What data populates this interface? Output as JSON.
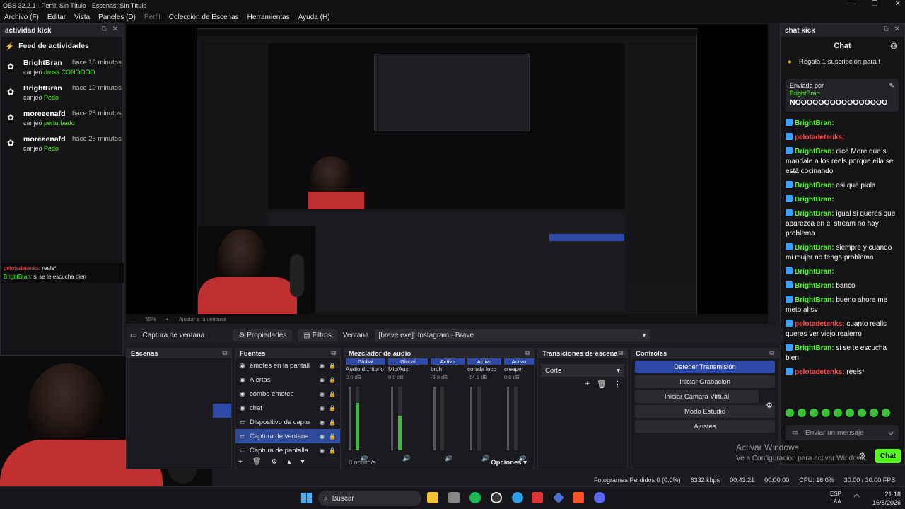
{
  "window": {
    "title": "OBS 32.2.1 - Perfil: Sin Título - Escenas: Sin Título"
  },
  "menu": {
    "items": [
      "Archivo (F)",
      "Editar",
      "Vista",
      "Paneles (D)",
      "Perfil",
      "Colección de Escenas",
      "Herramientas",
      "Ayuda (H)"
    ]
  },
  "activity": {
    "dock_title": "actividad kick",
    "feed_title": "Feed de actividades",
    "items": [
      {
        "name": "BrightBran",
        "time": "hace 16 minutos",
        "prefix": "canjeó",
        "reward": "dross COÑOOOO"
      },
      {
        "name": "BrightBran",
        "time": "hace 19 minutos",
        "prefix": "canjeó",
        "reward": "Pedo"
      },
      {
        "name": "moreeenafd",
        "time": "hace 25 minutos",
        "prefix": "canjeó",
        "reward": "perturbado"
      },
      {
        "name": "moreeenafd",
        "time": "hace 25 minutos",
        "prefix": "canjeó",
        "reward": "Pedo"
      }
    ]
  },
  "overlay_chat": [
    {
      "user": "pelotadetenks",
      "text": ": reels*"
    },
    {
      "user": "BrightBran",
      "text": ": si se te escucha bien"
    }
  ],
  "chat": {
    "dock_title": "chat kick",
    "header": "Chat",
    "sub_banner": "Regala 1 suscripción para t",
    "pinned_label": "Enviado por",
    "pinned_user": "BrightBran",
    "pinned_text": "NOOOOOOOOOOOOOOOO",
    "messages": [
      {
        "user": "BrightBran:",
        "text": "",
        "red": false
      },
      {
        "user": "pelotadetenks:",
        "text": "",
        "red": true
      },
      {
        "user": "BrightBran:",
        "text": "dice More que si, mandale a los reels porque ella se está cocinando",
        "red": false
      },
      {
        "user": "BrightBran:",
        "text": "asi que piola",
        "red": false
      },
      {
        "user": "BrightBran:",
        "text": "",
        "red": false
      },
      {
        "user": "BrightBran:",
        "text": "igual si querés que aparezca en el stream no hay problema",
        "red": false
      },
      {
        "user": "BrightBran:",
        "text": "siempre y cuando mi mujer no tenga problema",
        "red": false
      },
      {
        "user": "BrightBran:",
        "text": "",
        "red": false
      },
      {
        "user": "BrightBran:",
        "text": "banco",
        "red": false
      },
      {
        "user": "BrightBran:",
        "text": "bueno ahora me meto al sv",
        "red": false
      },
      {
        "user": "pelotadetenks:",
        "text": "cuanto realls queres ver viejo realerro",
        "red": true
      },
      {
        "user": "BrightBran:",
        "text": "si se te escucha bien",
        "red": false
      },
      {
        "user": "pelotadetenks:",
        "text": "reels*",
        "red": true
      }
    ],
    "input_placeholder": "Enviar un mensaje",
    "send_label": "Chat"
  },
  "preview_bar": {
    "zoom": "55%",
    "fit": "Ajustar a la ventana"
  },
  "source_bar": {
    "source_name": "Captura de ventana",
    "props_label": "Propiedades",
    "filters_label": "Filtros",
    "window_label": "Ventana",
    "window_value": "[brave.exe]: Instagram - Brave"
  },
  "panels": {
    "scenes_title": "Escenas",
    "sources_title": "Fuentes",
    "mixer_title": "Mezclador de audio",
    "transitions_title": "Transiciones de escena",
    "controls_title": "Controles"
  },
  "sources": [
    {
      "name": "emotes en la pantall",
      "selected": false
    },
    {
      "name": "Alertas",
      "selected": false
    },
    {
      "name": "combo emotes",
      "selected": false
    },
    {
      "name": "chat",
      "selected": false
    },
    {
      "name": "Dispositivo de captu",
      "selected": false
    },
    {
      "name": "Captura de ventana",
      "selected": true
    },
    {
      "name": "Captura de pantalla",
      "selected": false
    }
  ],
  "mixer": {
    "channels": [
      {
        "head": "Global",
        "name": "Audio d...ritorio",
        "db": "0.0 dB",
        "level": 0.75
      },
      {
        "head": "Global",
        "name": "Mic/Aux",
        "db": "0.0 dB",
        "level": 0.55
      },
      {
        "head": "Activo",
        "name": "bruh",
        "db": "-9.8 dB",
        "level": 0.0
      },
      {
        "head": "Activo",
        "name": "cortala loco",
        "db": "-14.1 dB",
        "level": 0.0
      },
      {
        "head": "Activo",
        "name": "creeper",
        "db": "0.0 dB",
        "level": 0.0
      }
    ],
    "hidden_label": "0 oculto/s",
    "options_label": "Opciones"
  },
  "transition": {
    "value": "Corte"
  },
  "controls": [
    "Detener Transmisión",
    "Iniciar Grabación",
    "Iniciar Cámara Virtual",
    "Modo Estudio",
    "Ajustes"
  ],
  "status": {
    "dropped": "Fotogramas Perdidos 0 (0.0%)",
    "bitrate": "6332 kbps",
    "stream_time": "00:43:21",
    "rec_time": "00:00:00",
    "cpu": "CPU: 16.0%",
    "fps": "30.00 / 30.00 FPS"
  },
  "watermark": {
    "line1": "Activar Windows",
    "line2": "Ve a Configuración para activar Windows."
  },
  "taskbar": {
    "search": "Buscar",
    "lang1": "ESP",
    "lang2": "LAA",
    "time": "21:18",
    "date": "16/8/2026"
  },
  "colors": {
    "kick_green": "#53fc18",
    "obs_blue": "#2e4aa8",
    "alert_red": "#ff4d4d"
  }
}
